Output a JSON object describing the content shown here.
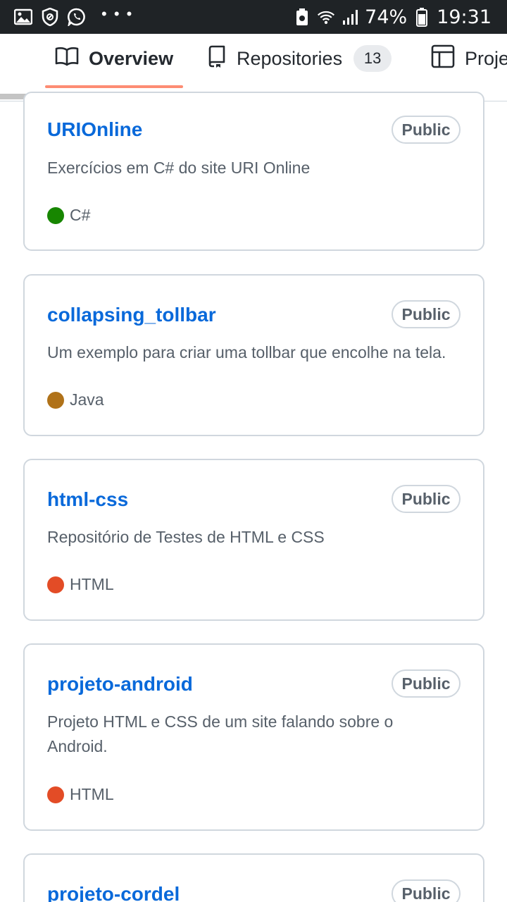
{
  "status_bar": {
    "battery": "74%",
    "time": "19:31",
    "icons": [
      "gallery-icon",
      "shield-icon",
      "whatsapp-icon",
      "more-dots-icon",
      "battery-saver-icon",
      "wifi-icon",
      "signal-icon",
      "battery-icon"
    ]
  },
  "tabs": [
    {
      "label": "Overview",
      "icon": "book-icon",
      "selected": true
    },
    {
      "label": "Repositories",
      "icon": "repo-icon",
      "count": "13"
    },
    {
      "label": "Projects",
      "icon": "project-icon"
    }
  ],
  "repositories": [
    {
      "name": "URIOnline",
      "visibility": "Public",
      "description": "Exercícios em C# do site URI Online",
      "language": "C#",
      "language_color": "#178600"
    },
    {
      "name": "collapsing_tollbar",
      "visibility": "Public",
      "description": "Um exemplo para criar uma tollbar que encolhe na tela.",
      "language": "Java",
      "language_color": "#b07219"
    },
    {
      "name": "html-css",
      "visibility": "Public",
      "description": "Repositório de Testes de HTML e CSS",
      "language": "HTML",
      "language_color": "#e34c26"
    },
    {
      "name": "projeto-android",
      "visibility": "Public",
      "description": "Projeto HTML e CSS de um site falando sobre o Android.",
      "language": "HTML",
      "language_color": "#e34c26"
    },
    {
      "name": "projeto-cordel",
      "visibility": "Public"
    }
  ],
  "colors": {
    "link": "#0969da",
    "tab_underline": "#fd8c73",
    "border": "#d0d7de",
    "status_bar": "#1f2326"
  }
}
